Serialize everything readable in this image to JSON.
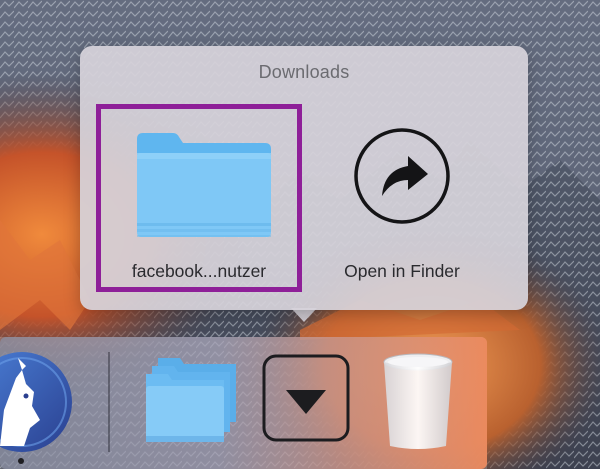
{
  "popover": {
    "title": "Downloads",
    "items": [
      {
        "label": "facebook...nutzer",
        "icon": "folder-icon",
        "selected": true
      },
      {
        "label": "Open in Finder",
        "icon": "open-in-finder-arrow-icon"
      }
    ]
  },
  "dock": {
    "items": [
      {
        "name": "app-icon-left",
        "icon": "goat-app-icon",
        "running": true
      },
      {
        "name": "documents-stack",
        "icon": "folder-stack-icon"
      },
      {
        "name": "downloads-stack",
        "icon": "download-arrow-icon",
        "active": true
      },
      {
        "name": "trash",
        "icon": "trash-icon"
      }
    ]
  },
  "colors": {
    "selection_border": "#8e1f98",
    "folder_blue": "#7fc8f6",
    "folder_tab": "#5fb6ef",
    "popover_bg": "#d6d3da",
    "dock_right": "#e88a62"
  }
}
